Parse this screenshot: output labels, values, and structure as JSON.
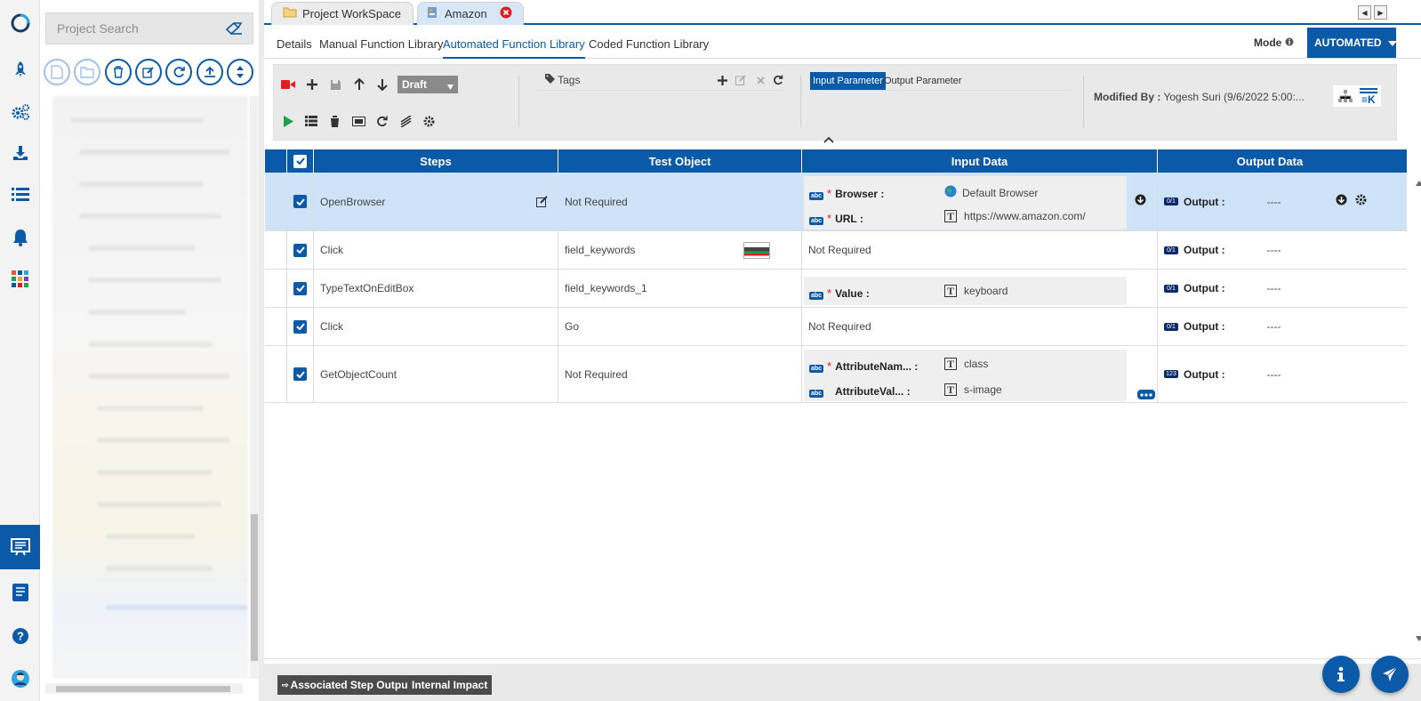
{
  "sidebar": {
    "icons": [
      "logo-icon",
      "rocket-icon",
      "gears-icon",
      "download-icon",
      "list-icon",
      "bell-icon",
      "apps-grid-icon",
      "test-plan-icon",
      "book-icon",
      "help-icon",
      "user-avatar-icon"
    ]
  },
  "tree": {
    "search_placeholder": "Project Search"
  },
  "tabs": {
    "workspace": "Project WorkSpace",
    "current": "Amazon"
  },
  "subtabs": [
    "Details",
    "Manual Function Library",
    "Automated Function Library",
    "Coded Function Library"
  ],
  "mode": {
    "label": "Mode",
    "value": "AUTOMATED"
  },
  "toolbar": {
    "status": "Draft",
    "tags_label": "Tags",
    "input_param": "Input Parameter",
    "output_param": "Output Parameter",
    "modified_label": "Modified By :",
    "modified_value": "Yogesh Suri (9/6/2022 5:00:..."
  },
  "grid": {
    "headers": {
      "steps": "Steps",
      "test_object": "Test Object",
      "input_data": "Input Data",
      "output_data": "Output Data"
    },
    "rows": [
      {
        "step": "OpenBrowser",
        "object": "Not Required",
        "inputs": [
          {
            "name": "Browser :",
            "value": "Default Browser"
          },
          {
            "name": "URL :",
            "value": "https://www.amazon.com/"
          }
        ],
        "output_label": "Output :",
        "output_value": "----"
      },
      {
        "step": "Click",
        "object": "field_keywords",
        "input_text": "Not Required",
        "output_label": "Output :",
        "output_value": "----"
      },
      {
        "step": "TypeTextOnEditBox",
        "object": "field_keywords_1",
        "inputs": [
          {
            "name": "Value :",
            "value": "keyboard"
          }
        ],
        "output_label": "Output :",
        "output_value": "----"
      },
      {
        "step": "Click",
        "object": "Go",
        "input_text": "Not Required",
        "output_label": "Output :",
        "output_value": "----"
      },
      {
        "step": "GetObjectCount",
        "object": "Not Required",
        "inputs": [
          {
            "name": "AttributeNam... :",
            "value": "class"
          },
          {
            "name": "AttributeVal... :",
            "value": "s-image"
          }
        ],
        "output_label": "Output :",
        "output_value": "----"
      }
    ],
    "type_badges": {
      "text": "abc",
      "bool": "0/1",
      "number": "123"
    }
  },
  "bottom": {
    "assoc": "Associated Step Output",
    "impact": "Internal Impact"
  },
  "colors": {
    "primary": "#0a5aa8",
    "selected_row": "#cfe3f8",
    "record": "#e02020",
    "play": "#1aa34a"
  }
}
